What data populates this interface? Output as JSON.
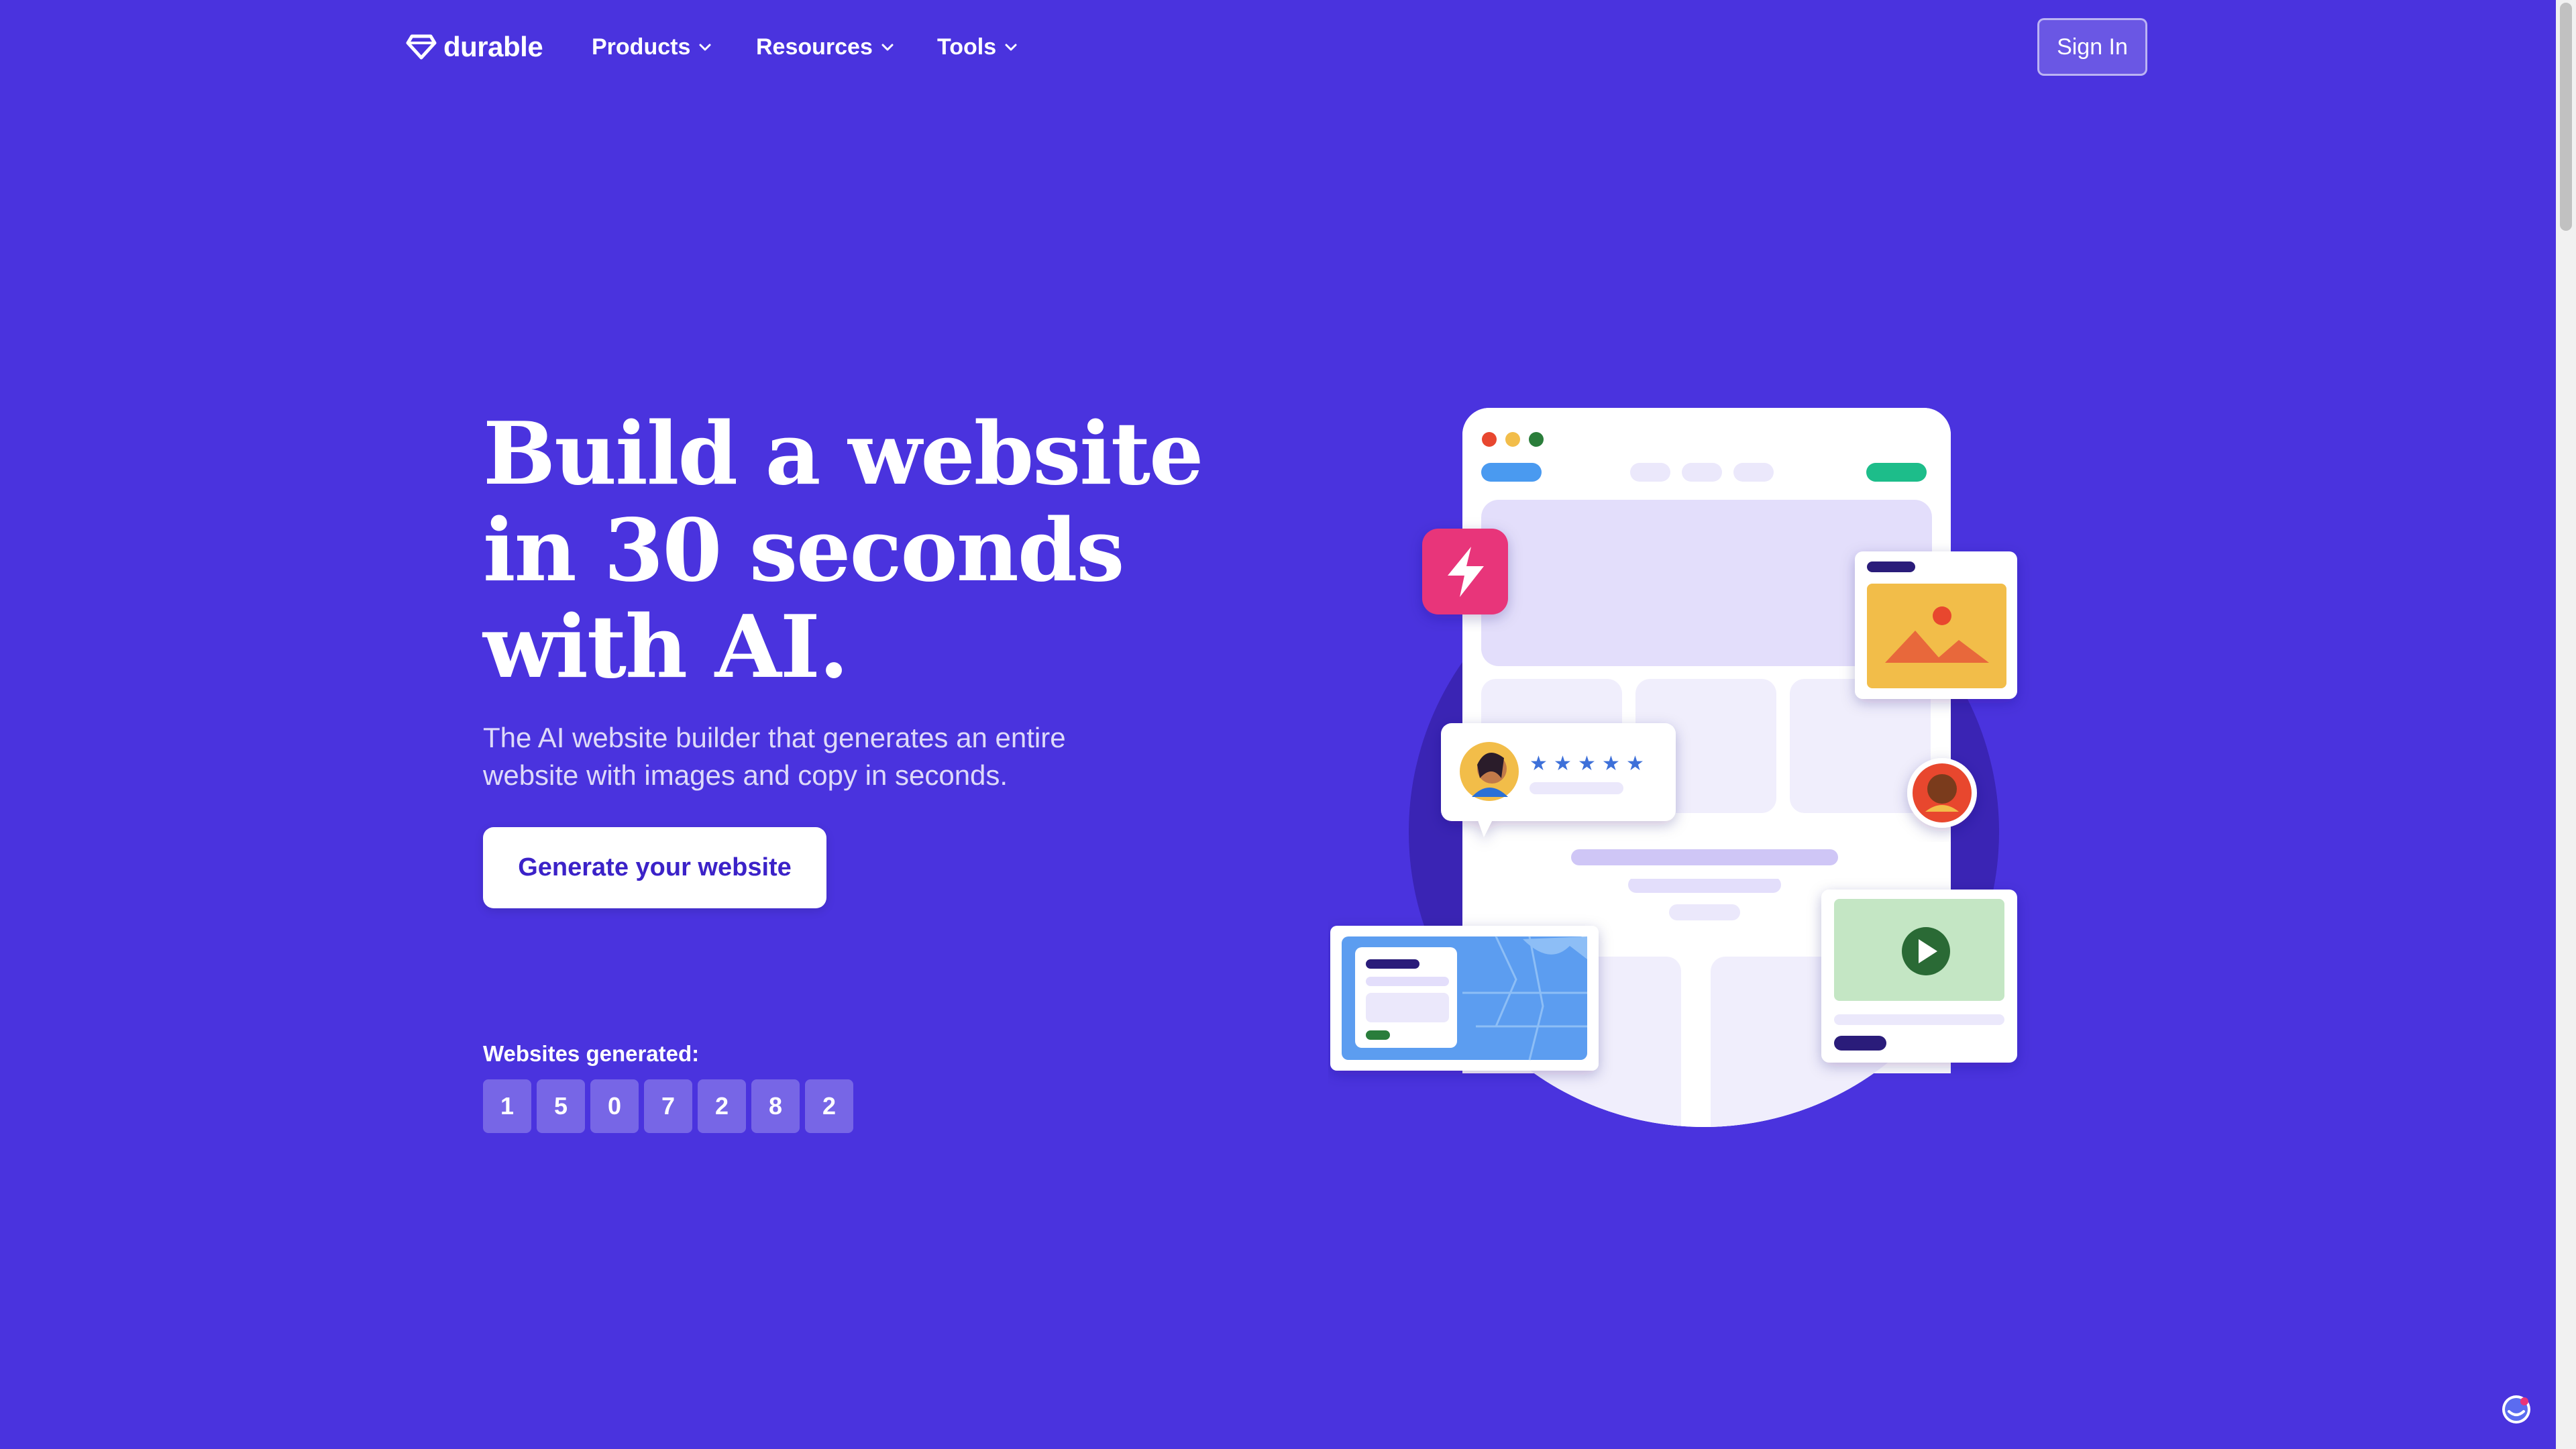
{
  "nav": {
    "logo_text": "durable",
    "items": [
      {
        "label": "Products"
      },
      {
        "label": "Resources"
      },
      {
        "label": "Tools"
      }
    ],
    "signin_label": "Sign In"
  },
  "hero": {
    "title_lines": [
      "Build a website",
      "in 30 seconds",
      "with AI."
    ],
    "subtitle": "The AI website builder that generates an entire website with images and copy in seconds.",
    "cta_label": "Generate your website"
  },
  "counter": {
    "label": "Websites generated:",
    "digits": [
      "1",
      "5",
      "0",
      "7",
      "2",
      "8",
      "2"
    ]
  },
  "colors": {
    "background": "#4a33de",
    "cta_text": "#3b22c8",
    "bolt_badge": "#e8347a",
    "accent_green": "#1dbd8a",
    "image_card": "#f2bd4a"
  },
  "icons": [
    "diamond-logo-icon",
    "chevron-down-icon",
    "bolt-icon",
    "image-icon",
    "play-icon",
    "star-icon",
    "chat-widget-icon"
  ]
}
